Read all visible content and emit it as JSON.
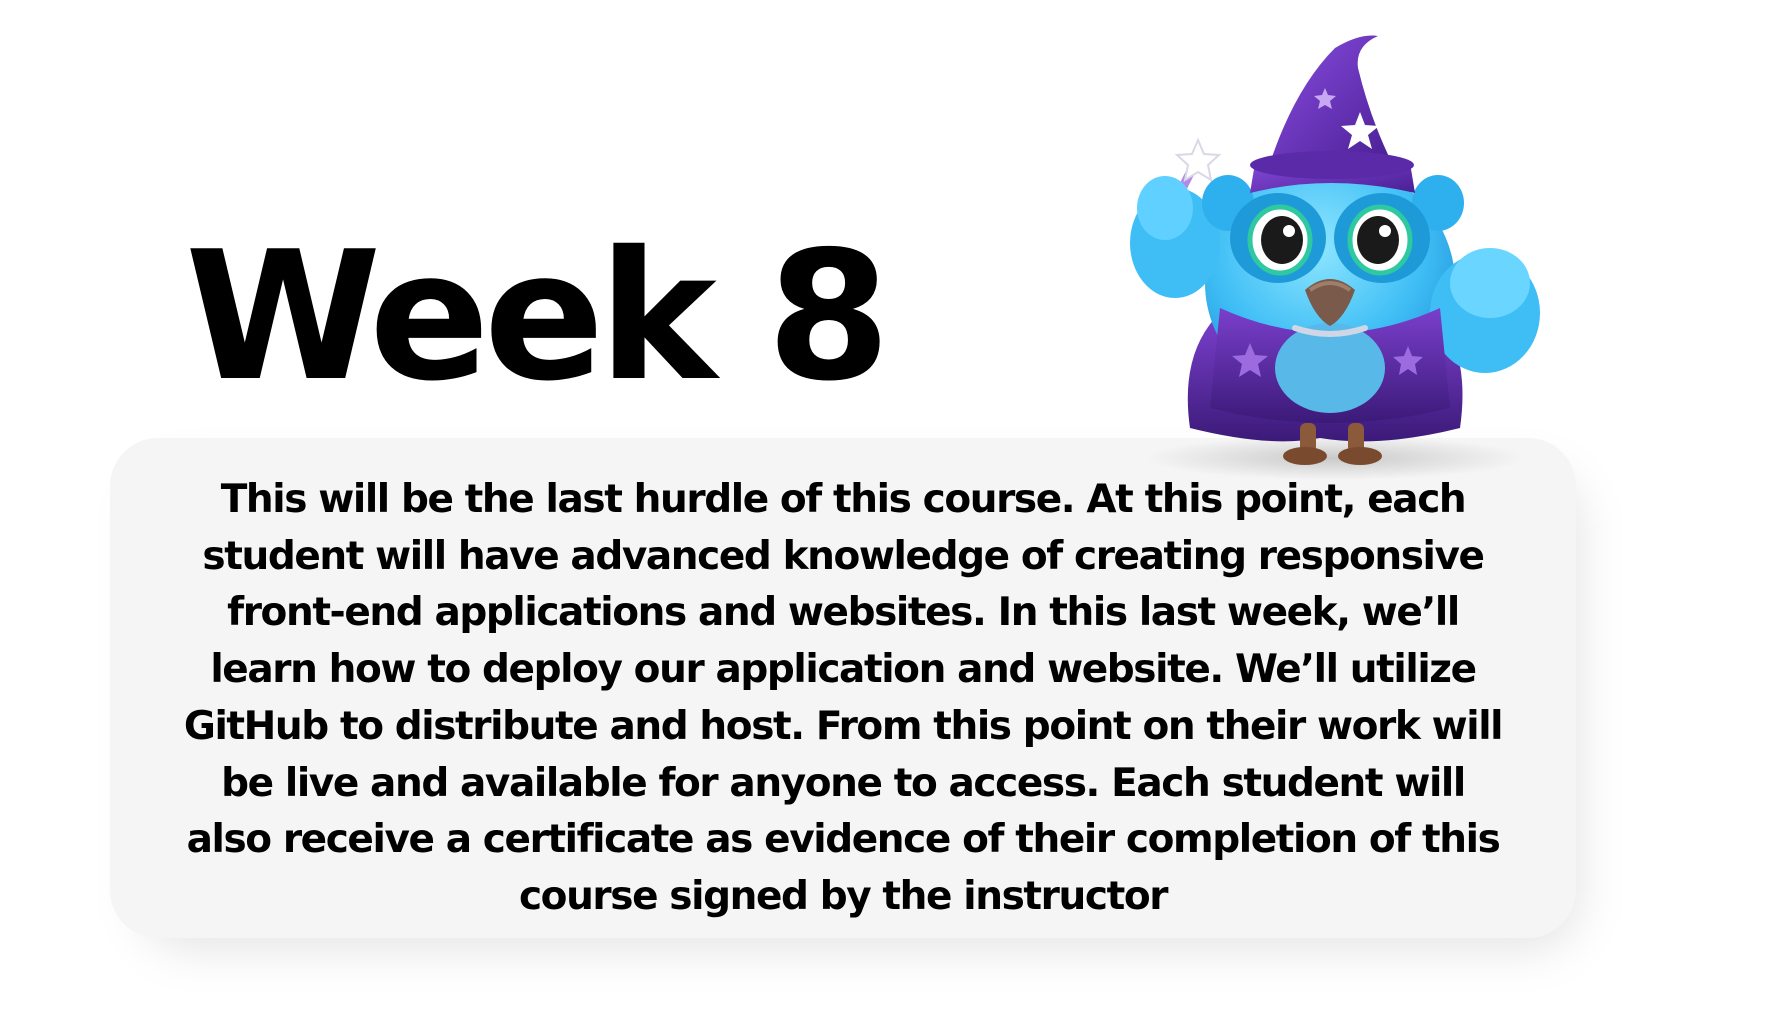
{
  "slide": {
    "title": "Week 8",
    "description": "This will be the last hurdle of this course. At this point, each student will have advanced knowledge of creating responsive front-end applications and websites. In this last week, we’ll learn how to deploy our application and website. We’ll utilize GitHub to distribute and host. From this point on their work will be live and available for anyone to access. Each student will also receive a certificate as evidence of their completion of this course signed by the instructor"
  },
  "mascot": {
    "icon": "wizard-owl-mascot-icon"
  },
  "colors": {
    "background": "#ffffff",
    "card": "#f5f5f5",
    "text": "#000000",
    "owl_body": "#3fbef5",
    "hat": "#6a2fb8",
    "cape": "#5a2a9a"
  }
}
